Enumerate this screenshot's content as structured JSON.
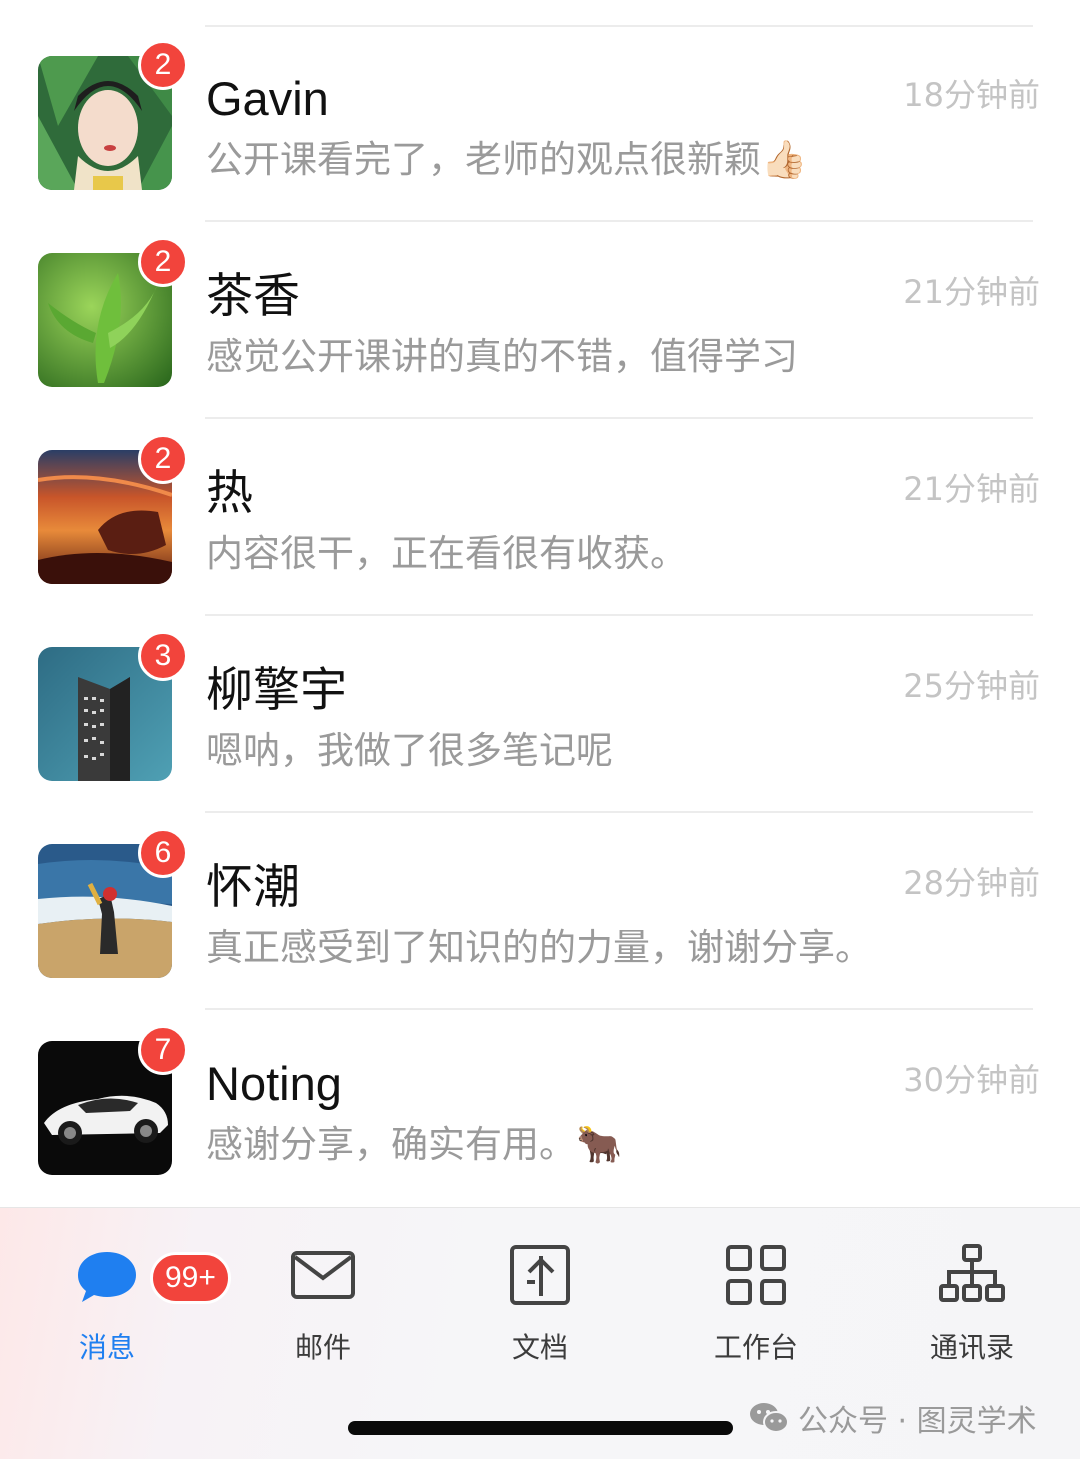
{
  "chats": [
    {
      "name": "Gavin",
      "time": "18分钟前",
      "preview": "公开课看完了，老师的观点很新颖👍🏻",
      "badge": "2",
      "avatar": "woman-leaves-portrait"
    },
    {
      "name": "茶香",
      "time": "21分钟前",
      "preview": "感觉公开课讲的真的不错，值得学习",
      "badge": "2",
      "avatar": "tea-leaves"
    },
    {
      "name": "热",
      "time": "21分钟前",
      "preview": "内容很干，正在看很有收获。",
      "badge": "2",
      "avatar": "sunset-rock"
    },
    {
      "name": "柳擎宇",
      "time": "25分钟前",
      "preview": "嗯呐，我做了很多笔记呢",
      "badge": "3",
      "avatar": "skyscraper"
    },
    {
      "name": "怀潮",
      "time": "28分钟前",
      "preview": "真正感受到了知识的的力量，谢谢分享。",
      "badge": "6",
      "avatar": "beach-person"
    },
    {
      "name": "Noting",
      "time": "30分钟前",
      "preview": "感谢分享，确实有用。🐂",
      "badge": "7",
      "avatar": "white-sports-car"
    }
  ],
  "tabbar": {
    "tabs": [
      {
        "label": "消息",
        "icon": "chat-bubble-icon",
        "active": true,
        "badge": "99+"
      },
      {
        "label": "邮件",
        "icon": "mail-icon",
        "active": false
      },
      {
        "label": "文档",
        "icon": "document-icon",
        "active": false
      },
      {
        "label": "工作台",
        "icon": "grid-icon",
        "active": false
      },
      {
        "label": "通讯录",
        "icon": "org-chart-icon",
        "active": false
      }
    ]
  },
  "watermark": {
    "text": "公众号 · 图灵学术",
    "icon": "wechat-icon"
  },
  "colors": {
    "accent": "#1f7ff0",
    "badge": "#f2443c",
    "time": "#c4c4c4",
    "preview": "#9a9a9a"
  }
}
